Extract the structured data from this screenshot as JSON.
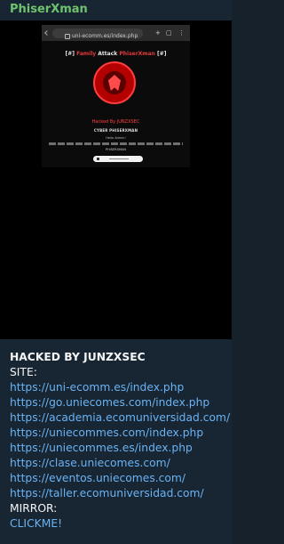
{
  "chat": {
    "sender_name": "PhiserXman"
  },
  "screenshot": {
    "url": "uni-ecomm.es/index.php",
    "headline_prefix": "[#]",
    "headline_red": "Family",
    "headline_mid": "Attack",
    "headline_red2": "PhiserXman",
    "headline_suffix": "[#]",
    "hacked_by": "Hacked By JUNZXSEC",
    "cyber_text": "CYBER PHISERXMAN",
    "hello_text": "Hello Admin!",
    "phiser_text": "PHISERXMAN"
  },
  "message": {
    "title": "HACKED BY JUNZXSEC",
    "site_label": "SITE:",
    "links": [
      "https://uni-ecomm.es/index.php",
      "https://go.uniecomes.com/index.php",
      "https://academia.ecomuniversidad.com/",
      "https://uniecommes.com/index.php",
      "https://uniecommes.es/index.php",
      "https://clase.uniecomes.com/",
      "https://eventos.uniecomes.com/",
      "https://taller.ecomuniversidad.com/"
    ],
    "mirror_label": "MIRROR:",
    "mirror_link": "CLICKME!"
  },
  "colors": {
    "background": "#182533",
    "sender": "#6fc36f",
    "link": "#6ab3f3",
    "accent_red": "#e23a3a"
  }
}
